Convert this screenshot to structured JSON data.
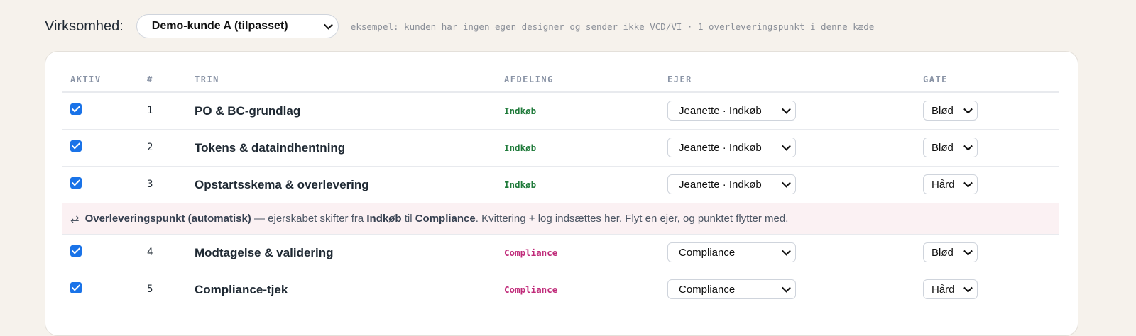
{
  "toolbar": {
    "company_label": "Virksomhed:",
    "company_selected": "Demo-kunde A (tilpasset)",
    "hint": "eksempel: kunden har ingen egen designer og sender ikke VCD/VI · 1 overleveringspunkt i denne kæde"
  },
  "table": {
    "headers": {
      "active": "AKTIV",
      "num": "#",
      "step": "TRIN",
      "department": "AFDELING",
      "owner": "EJER",
      "gate": "GATE"
    },
    "rows_before": [
      {
        "checked": true,
        "num": "1",
        "step": "PO & BC-grundlag",
        "department": "Indkøb",
        "owner": "Jeanette · Indkøb",
        "gate": "Blød"
      },
      {
        "checked": true,
        "num": "2",
        "step": "Tokens & dataindhentning",
        "department": "Indkøb",
        "owner": "Jeanette · Indkøb",
        "gate": "Blød"
      },
      {
        "checked": true,
        "num": "3",
        "step": "Opstartsskema & overlevering",
        "department": "Indkøb",
        "owner": "Jeanette · Indkøb",
        "gate": "Hård"
      }
    ],
    "handoff": {
      "icon": "swap-arrows-icon",
      "title": "Overleveringspunkt (automatisk)",
      "text1": " — ejerskabet skifter fra ",
      "from": "Indkøb",
      "text2": " til ",
      "to": "Compliance",
      "text3": ". Kvittering + log indsættes her. Flyt en ejer, og punktet flytter med."
    },
    "rows_after": [
      {
        "checked": true,
        "num": "4",
        "step": "Modtagelse & validering",
        "department": "Compliance",
        "owner": "Compliance",
        "gate": "Blød"
      },
      {
        "checked": true,
        "num": "5",
        "step": "Compliance-tjek",
        "department": "Compliance",
        "owner": "Compliance",
        "gate": "Hård"
      }
    ]
  },
  "colors": {
    "background": "#f6f2ec",
    "indkob": "#1f7a3a",
    "compliance": "#c02b7a",
    "checkbox": "#1a73e8",
    "handoff_bg": "#fbf1f3"
  }
}
